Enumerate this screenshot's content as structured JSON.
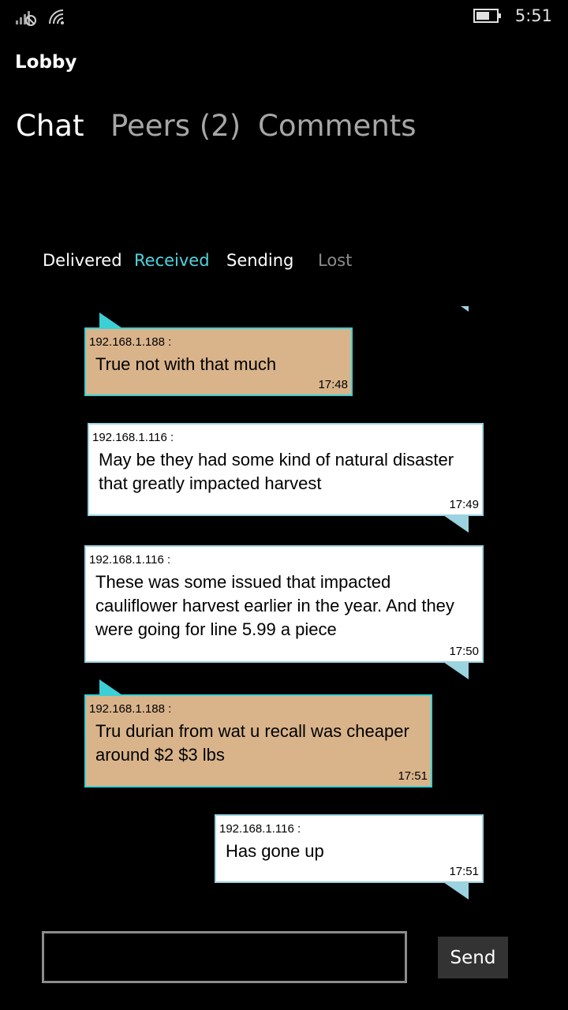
{
  "status_bar": {
    "time": "5:51",
    "icons": [
      "signal-bars-icon",
      "wifi-icon",
      "battery-icon"
    ]
  },
  "app": {
    "title": "Lobby"
  },
  "pivot": {
    "tabs": [
      "Chat",
      "Peers (2)",
      "Comments"
    ],
    "active_tab": "Chat"
  },
  "filters": {
    "delivered": "Delivered",
    "received": "Received",
    "sending": "Sending",
    "lost": "Lost",
    "colors": {
      "delivered": "#ffffff",
      "received": "#4fd4e0",
      "sending": "#ffffff",
      "lost": "#8a8a8a"
    }
  },
  "messages": [
    {
      "sender": "192.168.1.188 :",
      "lines": [
        "True not with that much"
      ],
      "time": "17:48",
      "direction": "outgoing"
    },
    {
      "sender": "192.168.1.116 :",
      "lines": [
        "May be they had some kind of natural disaster",
        "that greatly impacted harvest"
      ],
      "time": "17:49",
      "direction": "incoming"
    },
    {
      "sender": "192.168.1.116 :",
      "lines": [
        "These was some issued that impacted",
        "cauliflower harvest earlier in the year. And they",
        "were going for line 5.99 a piece"
      ],
      "time": "17:50",
      "direction": "incoming"
    },
    {
      "sender": "192.168.1.188 :",
      "lines": [
        "Tru durian from wat u recall was cheaper",
        "around $2 $3 lbs"
      ],
      "time": "17:51",
      "direction": "outgoing"
    },
    {
      "sender": "192.168.1.116 :",
      "lines": [
        "Has gone up"
      ],
      "time": "17:51",
      "direction": "incoming"
    }
  ],
  "compose": {
    "value": "",
    "send_label": "Send"
  },
  "colors": {
    "background": "#000000",
    "outgoing_bubble": "#d9b48b",
    "outgoing_border": "#3ccfd6",
    "incoming_bubble": "#ffffff",
    "incoming_border": "#9bd3e0"
  }
}
